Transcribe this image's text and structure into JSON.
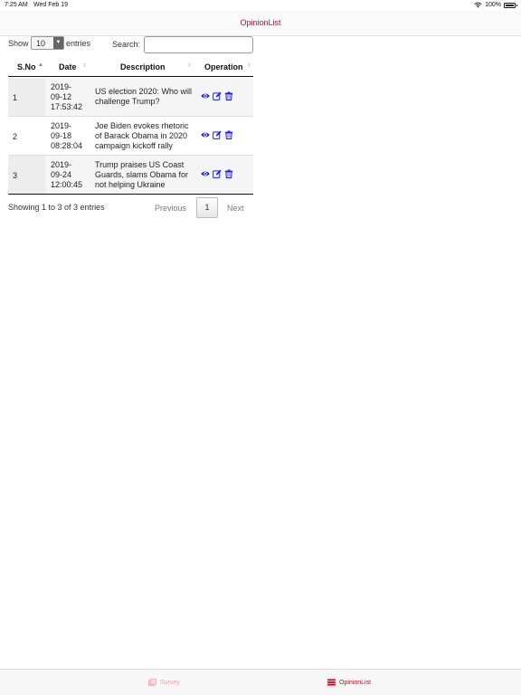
{
  "status_bar": {
    "time": "7:25 AM",
    "date": "Wed Feb 19",
    "battery": "100%"
  },
  "nav": {
    "title": "OpinionList"
  },
  "controls": {
    "show_label": "Show",
    "length_value": "10",
    "entries_label": "entries",
    "search_label": "Search:",
    "search_value": ""
  },
  "table": {
    "columns": [
      "S.No",
      "Date",
      "Description",
      "Operation"
    ],
    "rows": [
      {
        "sno": "1",
        "date": [
          "2019-",
          "09-12",
          "17:53:42"
        ],
        "description": "US election 2020: Who will challenge Trump?"
      },
      {
        "sno": "2",
        "date": [
          "2019-",
          "09-18",
          "08:28:04"
        ],
        "description": "Joe Biden evokes rhetoric of Barack Obama in 2020 campaign kickoff rally"
      },
      {
        "sno": "3",
        "date": [
          "2019-",
          "09-24",
          "12:00:45"
        ],
        "description": "Trump praises US Coast Guards, slams Obama for not helping Ukraine"
      }
    ]
  },
  "footer": {
    "info": "Showing 1 to 3 of 3 entries",
    "previous": "Previous",
    "page": "1",
    "next": "Next"
  },
  "tabs": [
    {
      "label": "Survey",
      "icon": "survey-icon"
    },
    {
      "label": "OpinionList",
      "icon": "list-icon"
    }
  ],
  "colors": {
    "accent": "#d0021b",
    "action_icons": "#1a1aff",
    "sort_active": "#6b7ec2"
  },
  "icons": {
    "view": "eye-icon",
    "edit": "edit-icon",
    "delete": "trash-icon"
  }
}
